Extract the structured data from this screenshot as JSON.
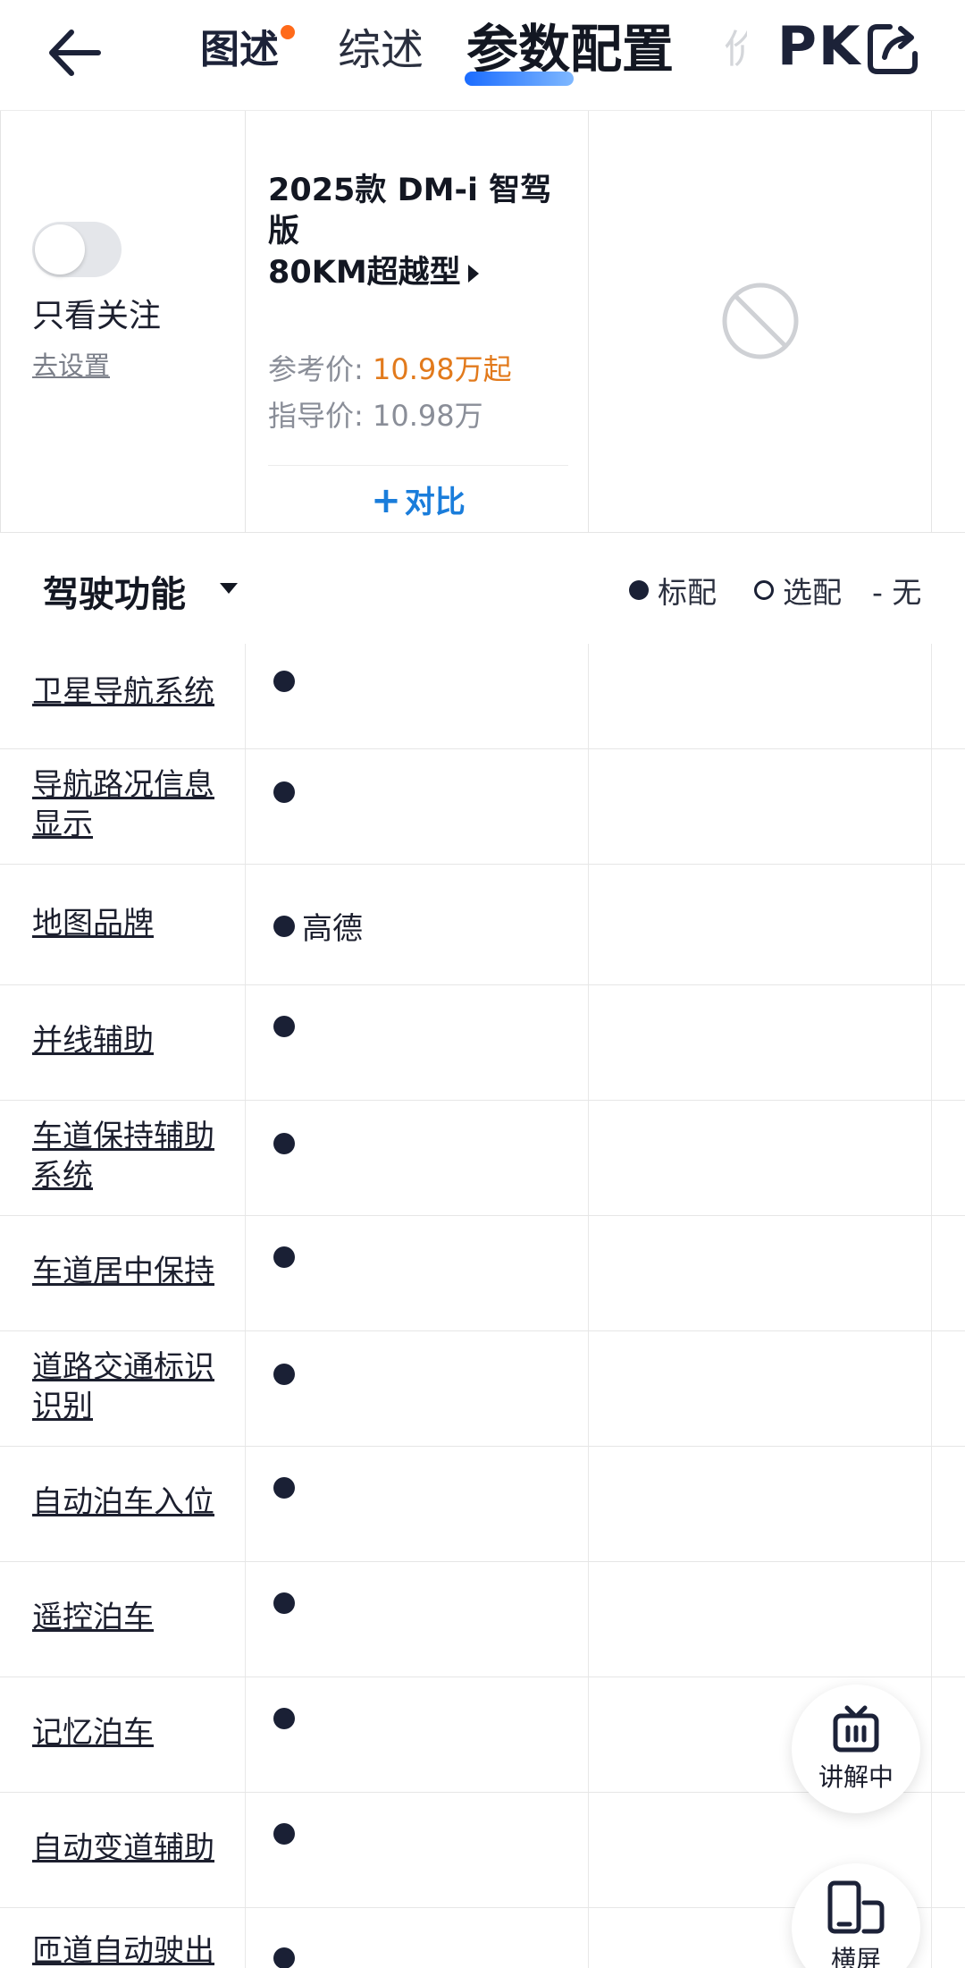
{
  "nav": {
    "tabs": [
      "图述",
      "综述",
      "参数配置",
      "价",
      "PK"
    ],
    "has_new_dot": true,
    "accent": "#1b6cff"
  },
  "car": {
    "follow_label": "只看关注",
    "settings_link": "去设置",
    "name_line1": "2025款 DM-i 智驾版",
    "name_line2": "80KM超越型",
    "ref_price_label": "参考价:",
    "ref_price_value": "10.98万起",
    "guide_price_label": "指导价:",
    "guide_price_value": "10.98万",
    "compare_label": "对比",
    "price_color": "#e27a1c",
    "compare_color": "#1a7ddb"
  },
  "section": {
    "title": "驾驶功能",
    "legend_standard": "标配",
    "legend_optional": "选配",
    "legend_none": "- 无"
  },
  "rows": [
    {
      "name": "卫星导航系统",
      "value": ""
    },
    {
      "name": "导航路况信息显示",
      "value": ""
    },
    {
      "name": "地图品牌",
      "value": "高德"
    },
    {
      "name": "并线辅助",
      "value": ""
    },
    {
      "name": "车道保持辅助系统",
      "value": ""
    },
    {
      "name": "车道居中保持",
      "value": ""
    },
    {
      "name": "道路交通标识识别",
      "value": ""
    },
    {
      "name": "自动泊车入位",
      "value": ""
    },
    {
      "name": "遥控泊车",
      "value": ""
    },
    {
      "name": "记忆泊车",
      "value": ""
    },
    {
      "name": "自动变道辅助",
      "value": ""
    },
    {
      "name": "匝道自动驶出",
      "value": ""
    }
  ],
  "float": {
    "live_label": "讲解中",
    "landscape_label": "横屏"
  }
}
